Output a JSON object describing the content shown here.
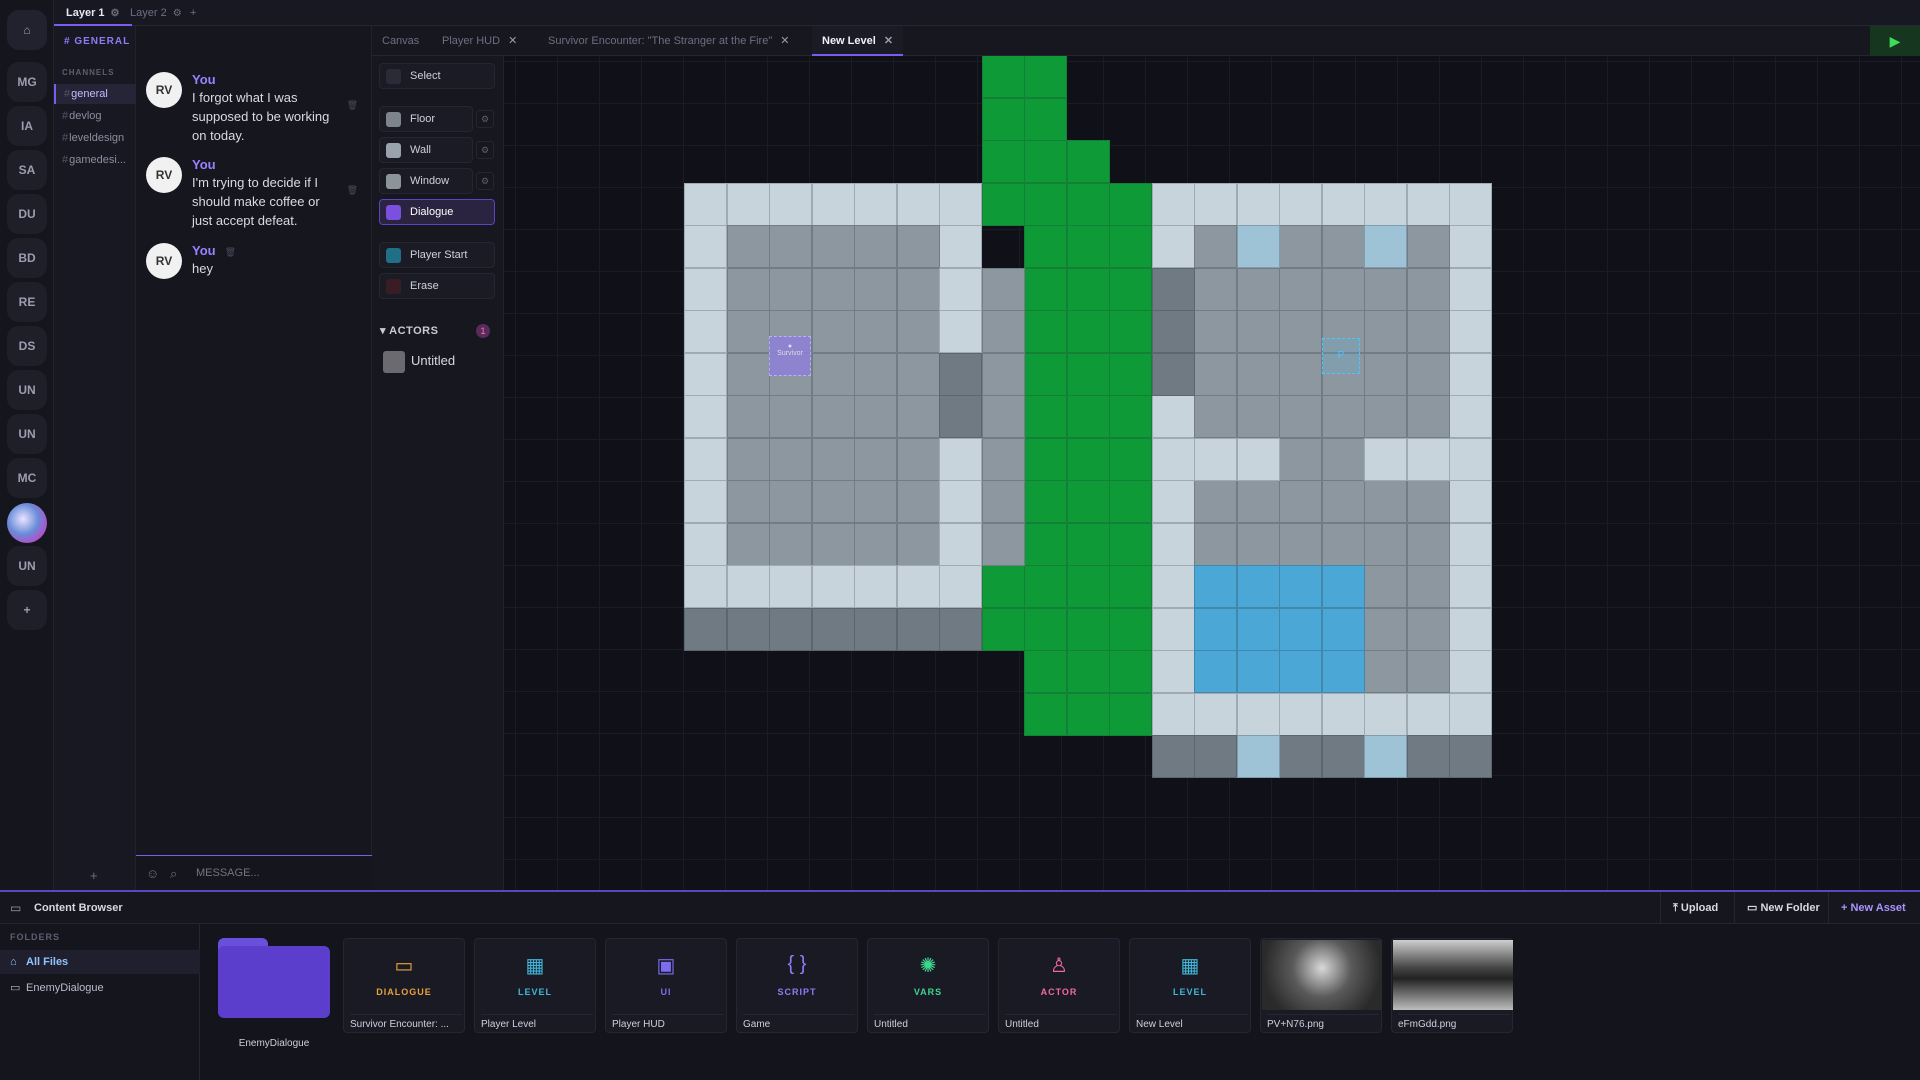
{
  "layers": [
    {
      "label": "Layer 1",
      "active": true
    },
    {
      "label": "Layer 2",
      "active": false
    }
  ],
  "add_layer": "+",
  "servers": [
    "MG",
    "IA",
    "SA",
    "DU",
    "BD",
    "RE",
    "DS",
    "UN",
    "UN",
    "MC",
    "UN"
  ],
  "add_server": "+",
  "home_icon": "⌂",
  "channel_panel": {
    "title": "# GENERAL",
    "section": "CHANNELS",
    "channels": [
      "general",
      "devlog",
      "leveldesign",
      "gamedesi..."
    ],
    "add": "+"
  },
  "chat": {
    "messages": [
      {
        "author": "You",
        "text": "I forgot what I was supposed to be working on today."
      },
      {
        "author": "You",
        "text": "I'm trying to decide if I should make coffee or just accept defeat."
      },
      {
        "author": "You",
        "text": "hey"
      }
    ],
    "placeholder": "MESSAGE..."
  },
  "doc_tabs": [
    {
      "label": "Canvas",
      "close": false
    },
    {
      "label": "Player HUD",
      "close": true
    },
    {
      "label": "Survivor Encounter: \"The Stranger at the Fire\"",
      "close": true
    },
    {
      "label": "New Level",
      "close": true,
      "active": true
    }
  ],
  "play_label": "▶",
  "tools": [
    {
      "label": "Select",
      "color": "#2b2b38",
      "icon": "cursor-icon"
    },
    {
      "label": "Floor",
      "color": "#7d848c",
      "icon": "floor-swatch"
    },
    {
      "label": "Wall",
      "color": "#9aa3ab",
      "icon": "wall-swatch"
    },
    {
      "label": "Window",
      "color": "#8d9499",
      "icon": "window-swatch"
    },
    {
      "label": "Dialogue",
      "color": "#7b4fe0",
      "icon": "dialogue-icon"
    },
    {
      "label": "Player Start",
      "color": "#1f6f86",
      "icon": "player-start-icon"
    },
    {
      "label": "Erase",
      "color": "#3a1c24",
      "icon": "erase-icon"
    }
  ],
  "actors": {
    "title": "ACTORS",
    "count": "1",
    "items": [
      "Untitled"
    ]
  },
  "content_browser": {
    "title": "Content Browser",
    "buttons": [
      "Upload",
      "New Folder",
      "New Asset"
    ],
    "folders_title": "FOLDERS",
    "folders": [
      "All Files",
      "EnemyDialogue"
    ],
    "folder_card": "EnemyDialogue",
    "assets": [
      {
        "type": "DIALOGUE",
        "name": "Survivor Encounter: ...",
        "color": "#e8a13a",
        "icon": "▭"
      },
      {
        "type": "LEVEL",
        "name": "Player Level",
        "color": "#3fb6d8",
        "icon": "▦"
      },
      {
        "type": "UI",
        "name": "Player HUD",
        "color": "#7b6cf0",
        "icon": "▣"
      },
      {
        "type": "SCRIPT",
        "name": "Game",
        "color": "#8f7bf5",
        "icon": "{ }"
      },
      {
        "type": "VARS",
        "name": "Untitled",
        "color": "#3ed68e",
        "icon": "✺"
      },
      {
        "type": "ACTOR",
        "name": "Untitled",
        "color": "#f06aa0",
        "icon": "♙"
      },
      {
        "type": "LEVEL",
        "name": "New Level",
        "color": "#3fb6d8",
        "icon": "▦"
      },
      {
        "type": "",
        "name": "PV+N76.png",
        "color": "#888888",
        "icon": ""
      },
      {
        "type": "",
        "name": "eFmGdd.png",
        "color": "#888888",
        "icon": ""
      }
    ]
  },
  "map_colors": {
    "wall": "#c7d4dc",
    "floor": "#8c979f",
    "grass": "#0f9a38",
    "water": "#4ba7d6",
    "dark": "#6f7a82",
    "shadow": "#5b656c"
  }
}
